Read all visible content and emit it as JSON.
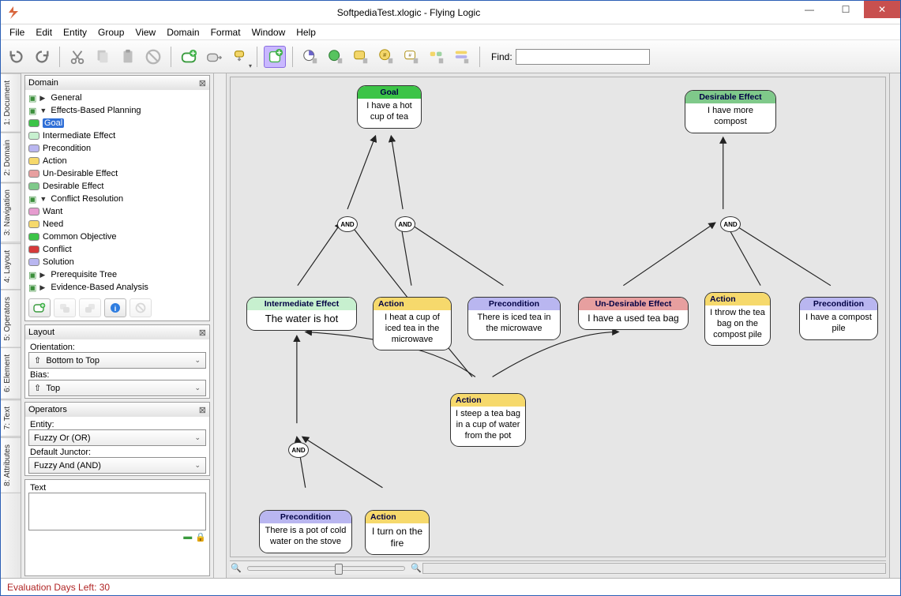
{
  "titlebar": {
    "title": "SoftpediaTest.xlogic - Flying Logic"
  },
  "menu": [
    "File",
    "Edit",
    "Entity",
    "Group",
    "View",
    "Domain",
    "Format",
    "Window",
    "Help"
  ],
  "toolbar": {
    "find_label": "Find:",
    "find_value": ""
  },
  "status": {
    "eval": "Evaluation Days Left: 30"
  },
  "side_tabs": [
    "1: Document",
    "2: Domain",
    "3: Navigation",
    "4: Layout",
    "5: Operators",
    "6: Element",
    "7: Text",
    "8: Attributes"
  ],
  "domain_panel": {
    "title": "Domain",
    "tree": {
      "general": "General",
      "ebp": "Effects-Based Planning",
      "ebp_items": [
        {
          "label": "Goal",
          "color": "#3cc447",
          "selected": true
        },
        {
          "label": "Intermediate Effect",
          "color": "#c7f0cf"
        },
        {
          "label": "Precondition",
          "color": "#b9b6f0"
        },
        {
          "label": "Action",
          "color": "#f6d96c"
        },
        {
          "label": "Un-Desirable Effect",
          "color": "#e79f9f"
        },
        {
          "label": "Desirable Effect",
          "color": "#7fc98a"
        }
      ],
      "cr": "Conflict Resolution",
      "cr_items": [
        {
          "label": "Want",
          "color": "#e69ccf"
        },
        {
          "label": "Need",
          "color": "#f6d96c"
        },
        {
          "label": "Common Objective",
          "color": "#3cc447"
        },
        {
          "label": "Conflict",
          "color": "#d63a3a"
        },
        {
          "label": "Solution",
          "color": "#b9b6f0"
        }
      ],
      "prereq": "Prerequisite Tree",
      "eba": "Evidence-Based Analysis"
    }
  },
  "layout_panel": {
    "title": "Layout",
    "orientation_label": "Orientation:",
    "orientation_value": "Bottom to Top",
    "bias_label": "Bias:",
    "bias_value": "Top"
  },
  "operators_panel": {
    "title": "Operators",
    "entity_label": "Entity:",
    "entity_value": "Fuzzy Or (OR)",
    "junctor_label": "Default Junctor:",
    "junctor_value": "Fuzzy And (AND)"
  },
  "text_panel": {
    "title": "Text"
  },
  "junctor_text": "AND",
  "nodes": {
    "goal": {
      "hdr": "Goal",
      "body": "I have a hot cup of tea"
    },
    "desirable": {
      "hdr": "Desirable Effect",
      "body": "I have more compost"
    },
    "intermed": {
      "hdr": "Intermediate Effect",
      "body": "The water is hot"
    },
    "action_heat": {
      "hdr": "Action",
      "body": "I heat a cup of iced tea in the microwave"
    },
    "pre_iced": {
      "hdr": "Precondition",
      "body": "There is iced tea in the microwave"
    },
    "undesir": {
      "hdr": "Un-Desirable Effect",
      "body": "I have a used tea bag"
    },
    "action_throw": {
      "hdr": "Action",
      "body": "I throw the tea bag on the compost pile"
    },
    "pre_pile": {
      "hdr": "Precondition",
      "body": "I have a compost pile"
    },
    "action_steep": {
      "hdr": "Action",
      "body": "I steep a tea bag in a cup of water from the pot"
    },
    "pre_pot": {
      "hdr": "Precondition",
      "body": "There is a pot of cold water on the stove"
    },
    "action_fire": {
      "hdr": "Action",
      "body": "I turn on the fire"
    }
  }
}
